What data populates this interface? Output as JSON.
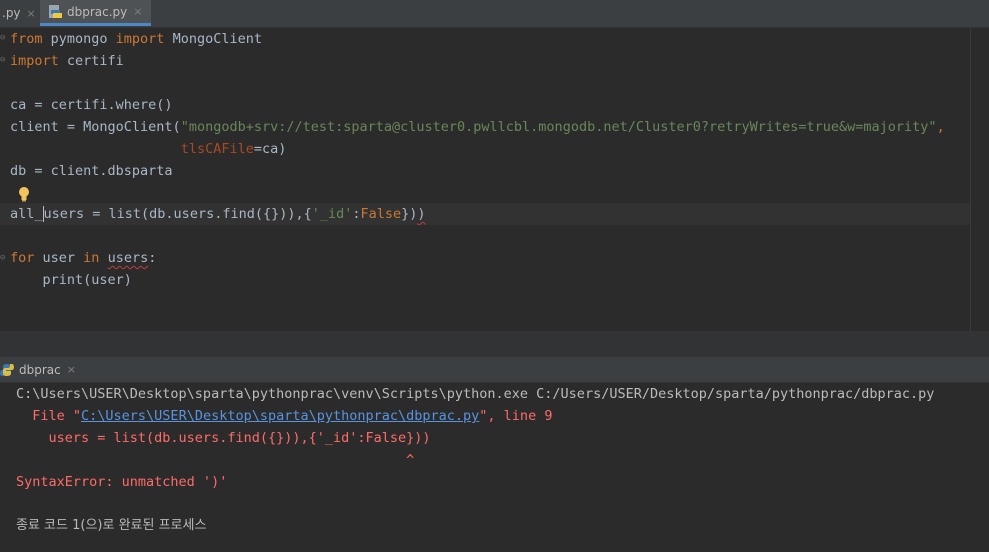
{
  "tabs": [
    {
      "label": ".py",
      "active": false
    },
    {
      "label": "dbprac.py",
      "active": true
    }
  ],
  "tab_close_glyph": "×",
  "editor": {
    "lines": {
      "l1_kw1": "from",
      "l1_mid": " pymongo ",
      "l1_kw2": "import",
      "l1_end": " MongoClient",
      "l2_kw": "import",
      "l2_end": " certifi",
      "l4": "ca = certifi.where()",
      "l5_pre": "client = MongoClient(",
      "l5_str": "\"mongodb+srv://test:sparta@cluster0.pwllcbl.mongodb.net/Cluster0?retryWrites=true&w=majority\"",
      "l5_comma": ",",
      "l6_pad": "                     ",
      "l6_param": "tlsCAFile",
      "l6_end": "=ca)",
      "l7": "db = client.dbsparta",
      "l9_a": "all_",
      "l9_b": "users = list(db.users.find({})),{",
      "l9_str": "'_id'",
      "l9_c": ":",
      "l9_kw": "False",
      "l9_d": "})",
      "l9_e": ")",
      "l11_kw1": "for",
      "l11_mid": " user ",
      "l11_kw2": "in",
      "l11_sp": " ",
      "l11_var": "users",
      "l11_end": ":",
      "l12": "    print(user)"
    }
  },
  "run_panel": {
    "tab_label": "dbprac"
  },
  "console": {
    "cmd": "C:\\Users\\USER\\Desktop\\sparta\\pythonprac\\venv\\Scripts\\python.exe C:/Users/USER/Desktop/sparta/pythonprac/dbprac.py",
    "file_pre": "  File \"",
    "file_link": "C:\\Users\\USER\\Desktop\\sparta\\pythonprac\\dbprac.py",
    "file_post": "\", line 9",
    "code": "    users = list(db.users.find({})),{'_id':False}))",
    "pointer": "                                                ^",
    "error": "SyntaxError: unmatched ')'",
    "exit": "종료 코드 1(으)로 완료된 프로세스"
  },
  "colors": {
    "keyword": "#cc7832",
    "string": "#6a8759",
    "param": "#aa4926",
    "error_red": "#ff6b68",
    "link": "#5894e0"
  }
}
